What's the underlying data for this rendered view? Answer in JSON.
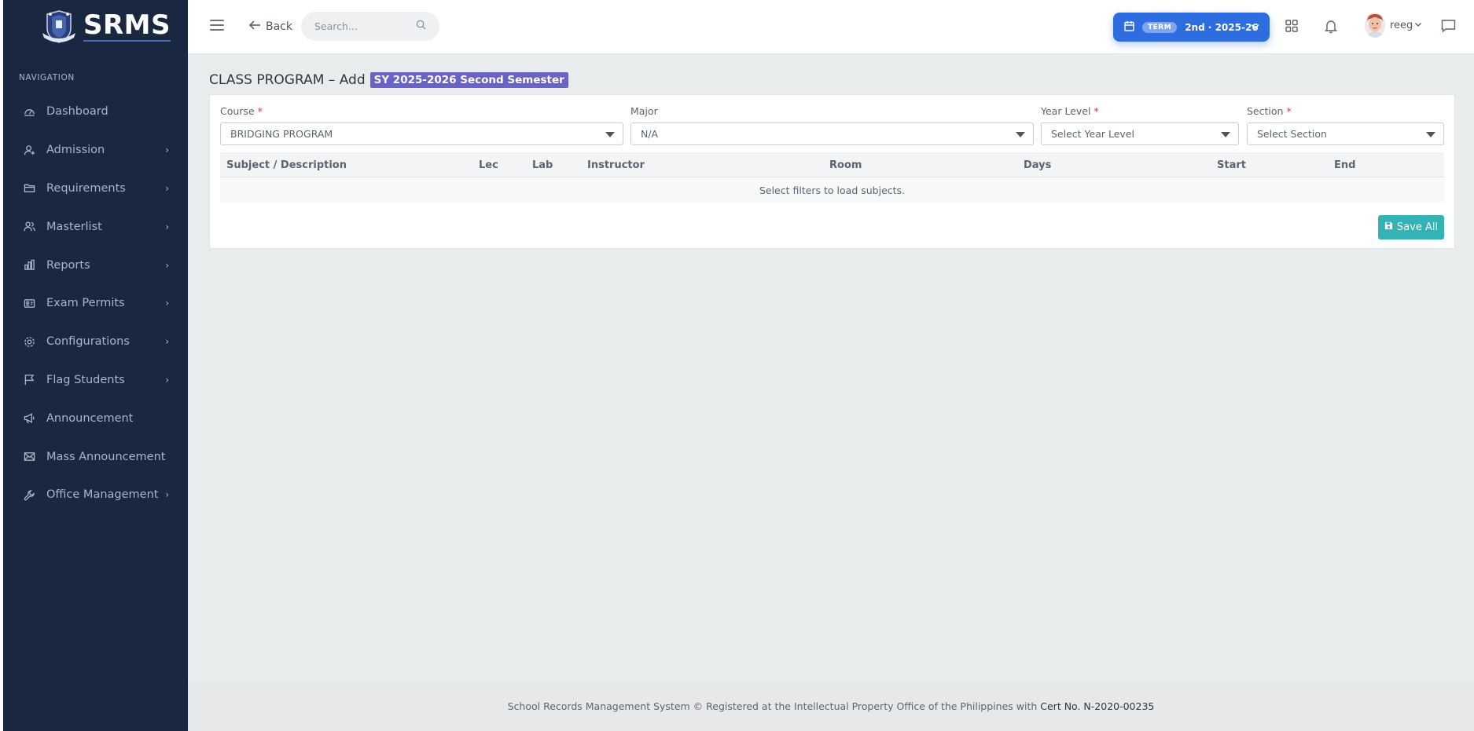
{
  "sidebar": {
    "brand": "SRMS",
    "nav_heading": "NAVIGATION",
    "items": [
      {
        "label": "Dashboard",
        "icon": "dashboard-icon",
        "has_children": false
      },
      {
        "label": "Admission",
        "icon": "user-add-icon",
        "has_children": true
      },
      {
        "label": "Requirements",
        "icon": "folder-icon",
        "has_children": true
      },
      {
        "label": "Masterlist",
        "icon": "users-icon",
        "has_children": true
      },
      {
        "label": "Reports",
        "icon": "bar-chart-icon",
        "has_children": true
      },
      {
        "label": "Exam Permits",
        "icon": "id-card-icon",
        "has_children": true
      },
      {
        "label": "Configurations",
        "icon": "gear-icon",
        "has_children": true
      },
      {
        "label": "Flag Students",
        "icon": "flag-icon",
        "has_children": true
      },
      {
        "label": "Announcement",
        "icon": "megaphone-icon",
        "has_children": false
      },
      {
        "label": "Mass Announcement",
        "icon": "mail-icon",
        "has_children": false
      },
      {
        "label": "Office Management",
        "icon": "wrench-icon",
        "has_children": true
      }
    ]
  },
  "topbar": {
    "back_label": "Back",
    "search_placeholder": "Search...",
    "term_badge": "TERM",
    "term_value": "2nd · 2025-26",
    "user_name": "reeg"
  },
  "page": {
    "title": "CLASS PROGRAM – Add",
    "sy_badge": "SY 2025-2026 Second Semester"
  },
  "filters": {
    "course": {
      "label": "Course",
      "required": "*",
      "value": "BRIDGING PROGRAM"
    },
    "major": {
      "label": "Major",
      "value": "N/A"
    },
    "year_level": {
      "label": "Year Level",
      "required": "*",
      "value": "Select Year Level"
    },
    "section": {
      "label": "Section",
      "required": "*",
      "value": "Select Section"
    }
  },
  "table": {
    "columns": [
      "Subject / Description",
      "Lec",
      "Lab",
      "Instructor",
      "Room",
      "Days",
      "Start",
      "End"
    ],
    "empty_message": "Select filters to load subjects."
  },
  "actions": {
    "save_all": "Save All"
  },
  "footer": {
    "text": "School Records Management System © Registered at the Intellectual Property Office of the Philippines with",
    "cert": "Cert No. N-2020-00235"
  },
  "colors": {
    "sidebar_bg": "#1a2740",
    "term_button": "#2d6ddf",
    "sy_badge": "#6a63c6",
    "save_button": "#34b3b6",
    "main_bg": "#e9eced"
  }
}
